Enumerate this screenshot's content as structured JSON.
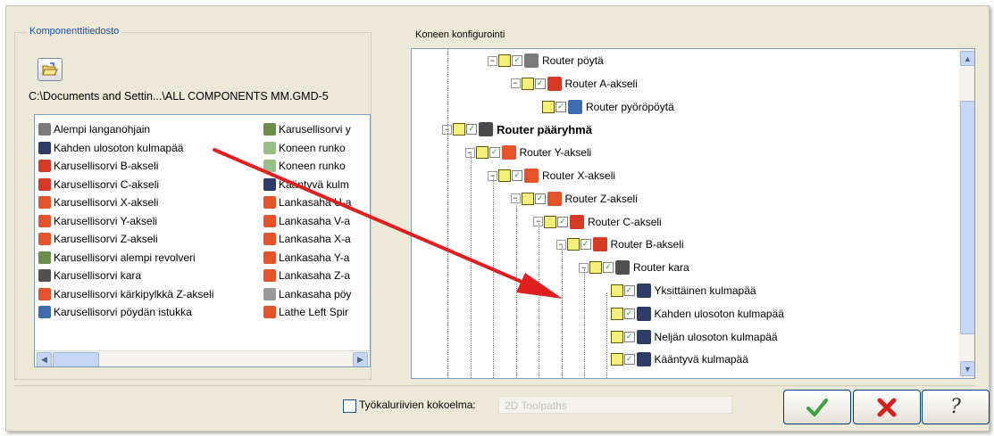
{
  "component_file": {
    "title": "Komponenttitiedosto",
    "path": "C:\\Documents and Settin...\\ALL COMPONENTS MM.GMD-5",
    "left_items": [
      {
        "label": "Alempi langanohjain",
        "icon": "wire-guide-icon",
        "color": "#7a7a7a"
      },
      {
        "label": "Kahden ulosoton kulmapää",
        "icon": "angle-head-icon",
        "color": "#2e3c68"
      },
      {
        "label": "Karusellisorvi B-akseli",
        "icon": "b-axis-icon",
        "color": "#d63a24"
      },
      {
        "label": "Karusellisorvi C-akseli",
        "icon": "c-axis-icon",
        "color": "#d63a24"
      },
      {
        "label": "Karusellisorvi X-akseli",
        "icon": "linear-axis-icon",
        "color": "#e5532a"
      },
      {
        "label": "Karusellisorvi Y-akseli",
        "icon": "linear-axis-icon",
        "color": "#e5532a"
      },
      {
        "label": "Karusellisorvi Z-akseli",
        "icon": "linear-axis-icon",
        "color": "#e5532a"
      },
      {
        "label": "Karusellisorvi alempi revolveri",
        "icon": "turret-icon",
        "color": "#6b8d4c"
      },
      {
        "label": "Karusellisorvi kara",
        "icon": "spindle-icon",
        "color": "#505050"
      },
      {
        "label": "Karusellisorvi kärkipylkkä Z-akseli",
        "icon": "tailstock-icon",
        "color": "#e5532a"
      },
      {
        "label": "Karusellisorvi pöydän istukka",
        "icon": "chuck-icon",
        "color": "#3d6db0"
      }
    ],
    "right_items": [
      {
        "label": "Karusellisorvi y",
        "icon": "turret-icon",
        "color": "#6b8d4c"
      },
      {
        "label": "Koneen runko",
        "icon": "folder-icon",
        "color": "#9bbf8a"
      },
      {
        "label": "Koneen runko",
        "icon": "folder-icon",
        "color": "#9bbf8a"
      },
      {
        "label": "Kääntyvä kulm",
        "icon": "angle-head-icon",
        "color": "#2e3c68"
      },
      {
        "label": "Lankasaha U-a",
        "icon": "linear-axis-icon",
        "color": "#e5532a"
      },
      {
        "label": "Lankasaha V-a",
        "icon": "linear-axis-icon",
        "color": "#e5532a"
      },
      {
        "label": "Lankasaha X-a",
        "icon": "linear-axis-icon",
        "color": "#e5532a"
      },
      {
        "label": "Lankasaha Y-a",
        "icon": "linear-axis-icon",
        "color": "#e5532a"
      },
      {
        "label": "Lankasaha Z-a",
        "icon": "linear-axis-icon",
        "color": "#e5532a"
      },
      {
        "label": "Lankasaha pöy",
        "icon": "wire-table-icon",
        "color": "#9a9a9a"
      },
      {
        "label": "Lathe Left Spir",
        "icon": "linear-axis-icon",
        "color": "#e5532a"
      }
    ]
  },
  "machine_config": {
    "title": "Koneen konfigurointi",
    "nodes": [
      {
        "label": "Router pöytä",
        "bold": false,
        "icon": "table-icon",
        "color": "#7a7a7a"
      },
      {
        "label": "Router A-akseli",
        "bold": false,
        "icon": "rotary-axis-icon",
        "color": "#d63a24"
      },
      {
        "label": "Router pyöröpöytä",
        "bold": false,
        "icon": "rotary-table-icon",
        "color": "#3d6db0"
      },
      {
        "label": "Router pääryhmä",
        "bold": true,
        "icon": "main-group-icon",
        "color": "#4a4a4a"
      },
      {
        "label": "Router Y-akseli",
        "bold": false,
        "icon": "linear-axis-icon",
        "color": "#e5532a"
      },
      {
        "label": "Router X-akseli",
        "bold": false,
        "icon": "linear-axis-icon",
        "color": "#e5532a"
      },
      {
        "label": "Router Z-akseli",
        "bold": false,
        "icon": "linear-axis-icon",
        "color": "#e5532a"
      },
      {
        "label": "Router C-akseli",
        "bold": false,
        "icon": "rotary-axis-icon",
        "color": "#d63a24"
      },
      {
        "label": "Router B-akseli",
        "bold": false,
        "icon": "rotary-axis-icon",
        "color": "#d63a24"
      },
      {
        "label": "Router kara",
        "bold": false,
        "icon": "spindle-icon",
        "color": "#505050"
      },
      {
        "label": "Yksittäinen kulmapää",
        "bold": false,
        "icon": "angle-head-icon",
        "color": "#2e3c68"
      },
      {
        "label": "Kahden ulosoton kulmapää",
        "bold": false,
        "icon": "angle-head-icon",
        "color": "#2e3c68"
      },
      {
        "label": "Neljän ulosoton kulmapää",
        "bold": false,
        "icon": "angle-head-icon",
        "color": "#2e3c68"
      },
      {
        "label": "Kääntyvä kulmapää",
        "bold": false,
        "icon": "angle-head-icon",
        "color": "#2e3c68"
      }
    ]
  },
  "footer": {
    "toolpath_label": "Työkaluriivien kokoelma:",
    "toolpath_value": "2D Toolpaths",
    "ok_icon": "check-icon",
    "cancel_icon": "x-icon",
    "help_icon": "help-icon"
  },
  "colors": {
    "arrow": "#e02020",
    "selection_box": "#f5f07a",
    "check": "#2b9b2b"
  }
}
